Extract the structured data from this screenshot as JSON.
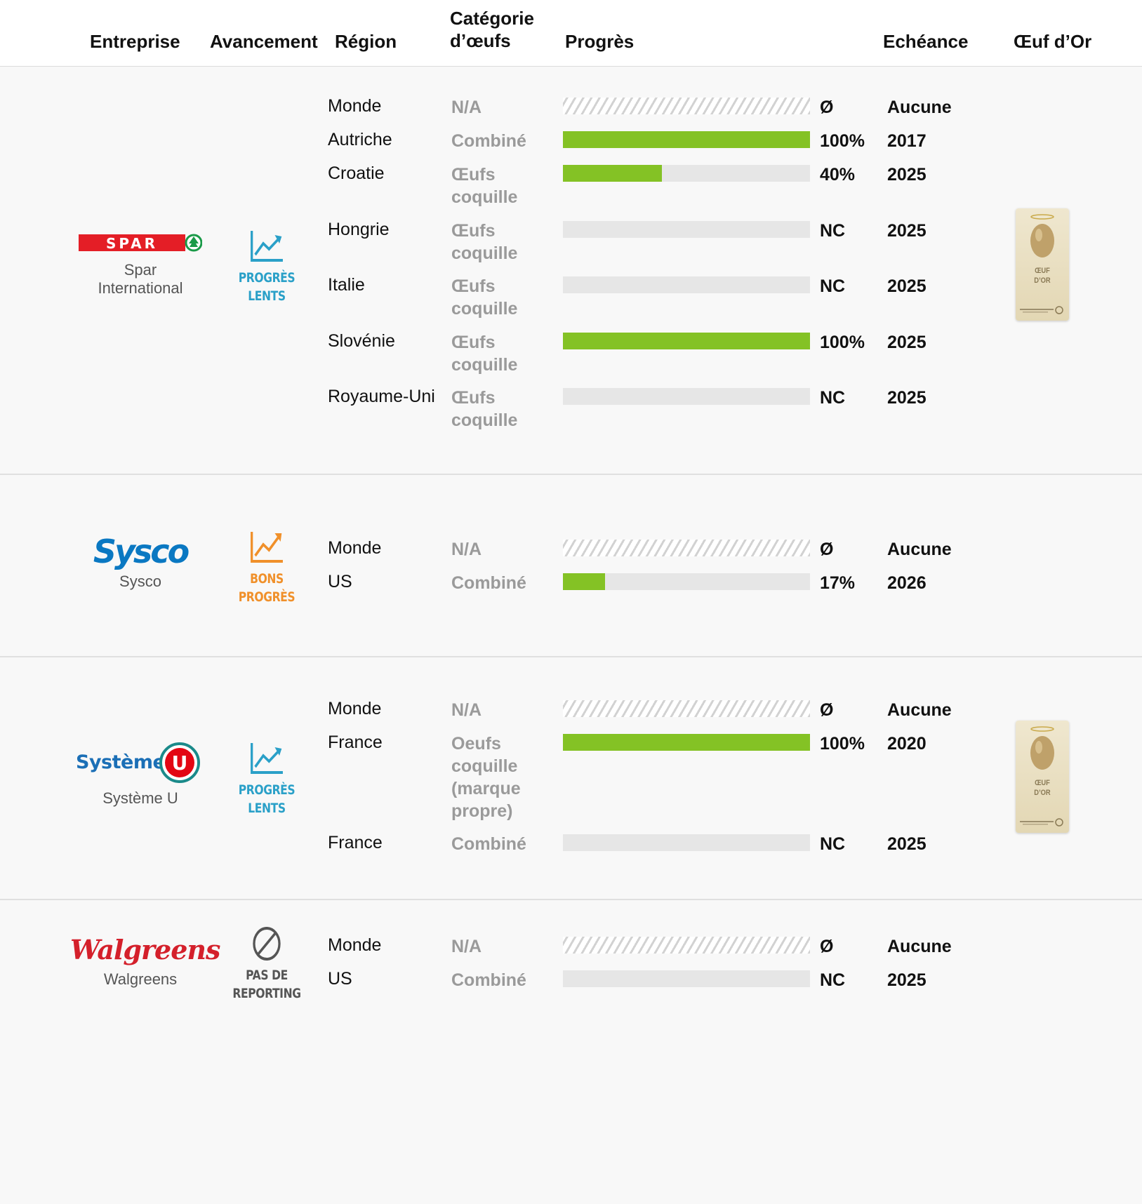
{
  "headers": {
    "company": "Entreprise",
    "progress_status": "Avancement",
    "region": "Région",
    "category": "Catégorie d’œufs",
    "progress": "Progrès",
    "deadline": "Echéance",
    "golden_egg": "Œuf d’Or"
  },
  "colors": {
    "progress_fill": "#84c225",
    "progress_track": "#e6e6e6",
    "slow_progress": "#2aa0c8",
    "good_progress": "#f0902a",
    "no_reporting": "#555555",
    "spar_red": "#e41e26",
    "spar_green": "#1a9a48",
    "sysco_blue": "#0a78c2",
    "systeme_u_blue": "#1b6fb6",
    "systeme_u_red": "#e30613",
    "walgreens_red": "#d4202b"
  },
  "companies": [
    {
      "logo_text": "SPAR",
      "name": "Spar International",
      "status": [
        "PROGRÈS",
        "LENTS"
      ],
      "status_icon": "trend-up-icon",
      "golden_egg_award": true,
      "golden_egg_label": [
        "ŒUF",
        "D’OR"
      ],
      "rows": [
        {
          "region": "Monde",
          "category": "N/A",
          "progress": null,
          "label": "Ø",
          "deadline": "Aucune"
        },
        {
          "region": "Autriche",
          "category": "Combiné",
          "progress": 100,
          "label": "100%",
          "deadline": "2017"
        },
        {
          "region": "Croatie",
          "category": "Œufs coquille",
          "progress": 40,
          "label": "40%",
          "deadline": "2025"
        },
        {
          "region": "Hongrie",
          "category": "Œufs coquille",
          "progress": 0,
          "label": "NC",
          "deadline": "2025"
        },
        {
          "region": "Italie",
          "category": "Œufs coquille",
          "progress": 0,
          "label": "NC",
          "deadline": "2025"
        },
        {
          "region": "Slovénie",
          "category": "Œufs coquille",
          "progress": 100,
          "label": "100%",
          "deadline": "2025"
        },
        {
          "region": "Royaume-Uni",
          "category": "Œufs coquille",
          "progress": 0,
          "label": "NC",
          "deadline": "2025"
        }
      ]
    },
    {
      "logo_text": "Sysco",
      "name": "Sysco",
      "status": [
        "BONS",
        "PROGRÈS"
      ],
      "status_icon": "trend-up-icon",
      "golden_egg_award": false,
      "rows": [
        {
          "region": "Monde",
          "category": "N/A",
          "progress": null,
          "label": "Ø",
          "deadline": "Aucune"
        },
        {
          "region": "US",
          "category": "Combiné",
          "progress": 17,
          "label": "17%",
          "deadline": "2026"
        }
      ]
    },
    {
      "logo_text": "Système",
      "logo_letter": "U",
      "name": "Système U",
      "status": [
        "PROGRÈS",
        "LENTS"
      ],
      "status_icon": "trend-up-icon",
      "golden_egg_award": true,
      "golden_egg_label": [
        "ŒUF",
        "D’OR"
      ],
      "rows": [
        {
          "region": "Monde",
          "category": "N/A",
          "progress": null,
          "label": "Ø",
          "deadline": "Aucune"
        },
        {
          "region": "France",
          "category": "Oeufs coquille (marque propre)",
          "progress": 100,
          "label": "100%",
          "deadline": "2020"
        },
        {
          "region": "France",
          "category": "Combiné",
          "progress": 0,
          "label": "NC",
          "deadline": "2025"
        }
      ]
    },
    {
      "logo_text": "Walgreens",
      "name": "Walgreens",
      "status": [
        "PAS DE",
        "REPORTING"
      ],
      "status_icon": "prohibited-icon",
      "golden_egg_award": false,
      "rows": [
        {
          "region": "Monde",
          "category": "N/A",
          "progress": null,
          "label": "Ø",
          "deadline": "Aucune"
        },
        {
          "region": "US",
          "category": "Combiné",
          "progress": 0,
          "label": "NC",
          "deadline": "2025"
        }
      ]
    }
  ]
}
